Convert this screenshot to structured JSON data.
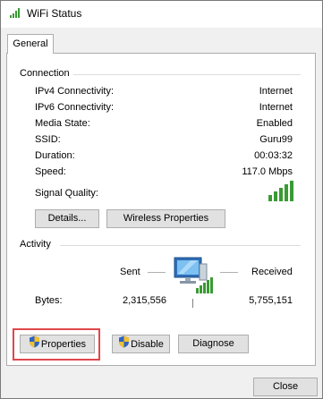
{
  "window": {
    "title": "WiFi Status",
    "icon": "wifi-signal-icon"
  },
  "tabs": [
    {
      "label": "General",
      "selected": true
    }
  ],
  "connection": {
    "heading": "Connection",
    "rows": [
      {
        "label": "IPv4 Connectivity:",
        "value": "Internet"
      },
      {
        "label": "IPv6 Connectivity:",
        "value": "Internet"
      },
      {
        "label": "Media State:",
        "value": "Enabled"
      },
      {
        "label": "SSID:",
        "value": "Guru99"
      },
      {
        "label": "Duration:",
        "value": "00:03:32"
      },
      {
        "label": "Speed:",
        "value": "117.0 Mbps"
      }
    ],
    "signal_quality_label": "Signal Quality:",
    "signal_bars": 5,
    "signal_color": "#3a9a34",
    "details_button": "Details...",
    "wireless_properties_button": "Wireless Properties"
  },
  "activity": {
    "heading": "Activity",
    "sent_label": "Sent",
    "received_label": "Received",
    "bytes_label": "Bytes:",
    "bytes_sent": "2,315,556",
    "bytes_received": "5,755,151",
    "icon": "network-computer-icon"
  },
  "actions": {
    "properties_button": "Properties",
    "disable_button": "Disable",
    "diagnose_button": "Diagnose",
    "highlight_color": "#e0474c"
  },
  "footer": {
    "close_button": "Close"
  }
}
